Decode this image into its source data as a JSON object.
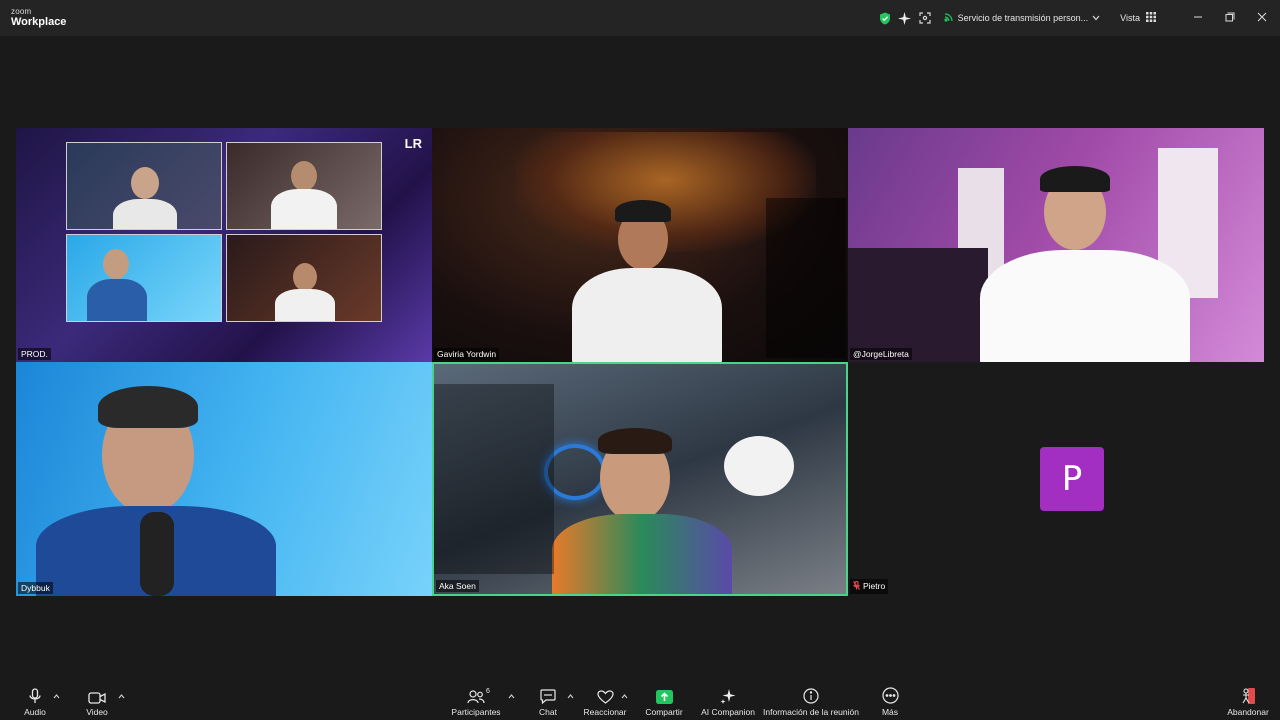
{
  "app": {
    "brand_top": "zoom",
    "brand_bottom": "Workplace"
  },
  "titlebar": {
    "stream_label": "Servicio de transmisión person...",
    "view_label": "Vista"
  },
  "participants": [
    {
      "name": "PROD."
    },
    {
      "name": "Gaviria Yordwin"
    },
    {
      "name": "@JorgeLibreta"
    },
    {
      "name": "Dybbuk"
    },
    {
      "name": "Aka Soen"
    },
    {
      "name": "Pietro",
      "muted": true,
      "avatar_letter": "P"
    }
  ],
  "tile_logo": "LR",
  "toolbar": {
    "audio": "Audio",
    "video": "Video",
    "participants": "Participantes",
    "participants_count": "6",
    "chat": "Chat",
    "react": "Reaccionar",
    "share": "Compartir",
    "ai": "AI Companion",
    "info": "Información de la reunión",
    "more": "Más",
    "leave": "Abandonar"
  },
  "colors": {
    "active_speaker": "#4bd38a",
    "share_green": "#22c55e",
    "avatar_purple": "#a22fc2",
    "leave_red": "#e24b4b",
    "shield_green": "#22c55e"
  },
  "icons": {
    "shield": "shield-check-icon",
    "sparkle": "ai-sparkle-icon",
    "fullscreen": "fullscreen-icon",
    "stream": "live-stream-icon"
  }
}
